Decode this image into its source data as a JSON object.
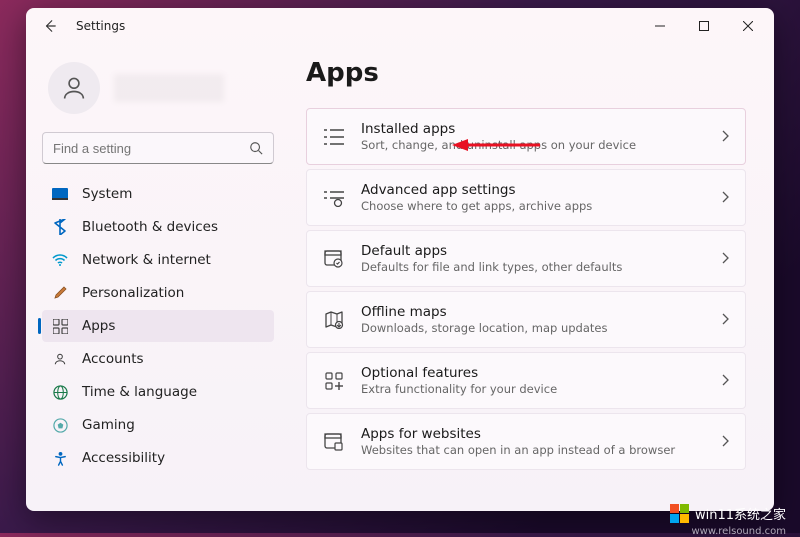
{
  "titlebar": {
    "title": "Settings"
  },
  "search": {
    "placeholder": "Find a setting"
  },
  "sidebar": {
    "items": [
      {
        "label": "System"
      },
      {
        "label": "Bluetooth & devices"
      },
      {
        "label": "Network & internet"
      },
      {
        "label": "Personalization"
      },
      {
        "label": "Apps"
      },
      {
        "label": "Accounts"
      },
      {
        "label": "Time & language"
      },
      {
        "label": "Gaming"
      },
      {
        "label": "Accessibility"
      }
    ]
  },
  "page": {
    "title": "Apps"
  },
  "cards": [
    {
      "title": "Installed apps",
      "sub": "Sort, change, and uninstall apps on your device"
    },
    {
      "title": "Advanced app settings",
      "sub": "Choose where to get apps, archive apps"
    },
    {
      "title": "Default apps",
      "sub": "Defaults for file and link types, other defaults"
    },
    {
      "title": "Offline maps",
      "sub": "Downloads, storage location, map updates"
    },
    {
      "title": "Optional features",
      "sub": "Extra functionality for your device"
    },
    {
      "title": "Apps for websites",
      "sub": "Websites that can open in an app instead of a browser"
    }
  ],
  "watermark": {
    "text": "win11系统之家",
    "sub": "www.relsound.com"
  }
}
